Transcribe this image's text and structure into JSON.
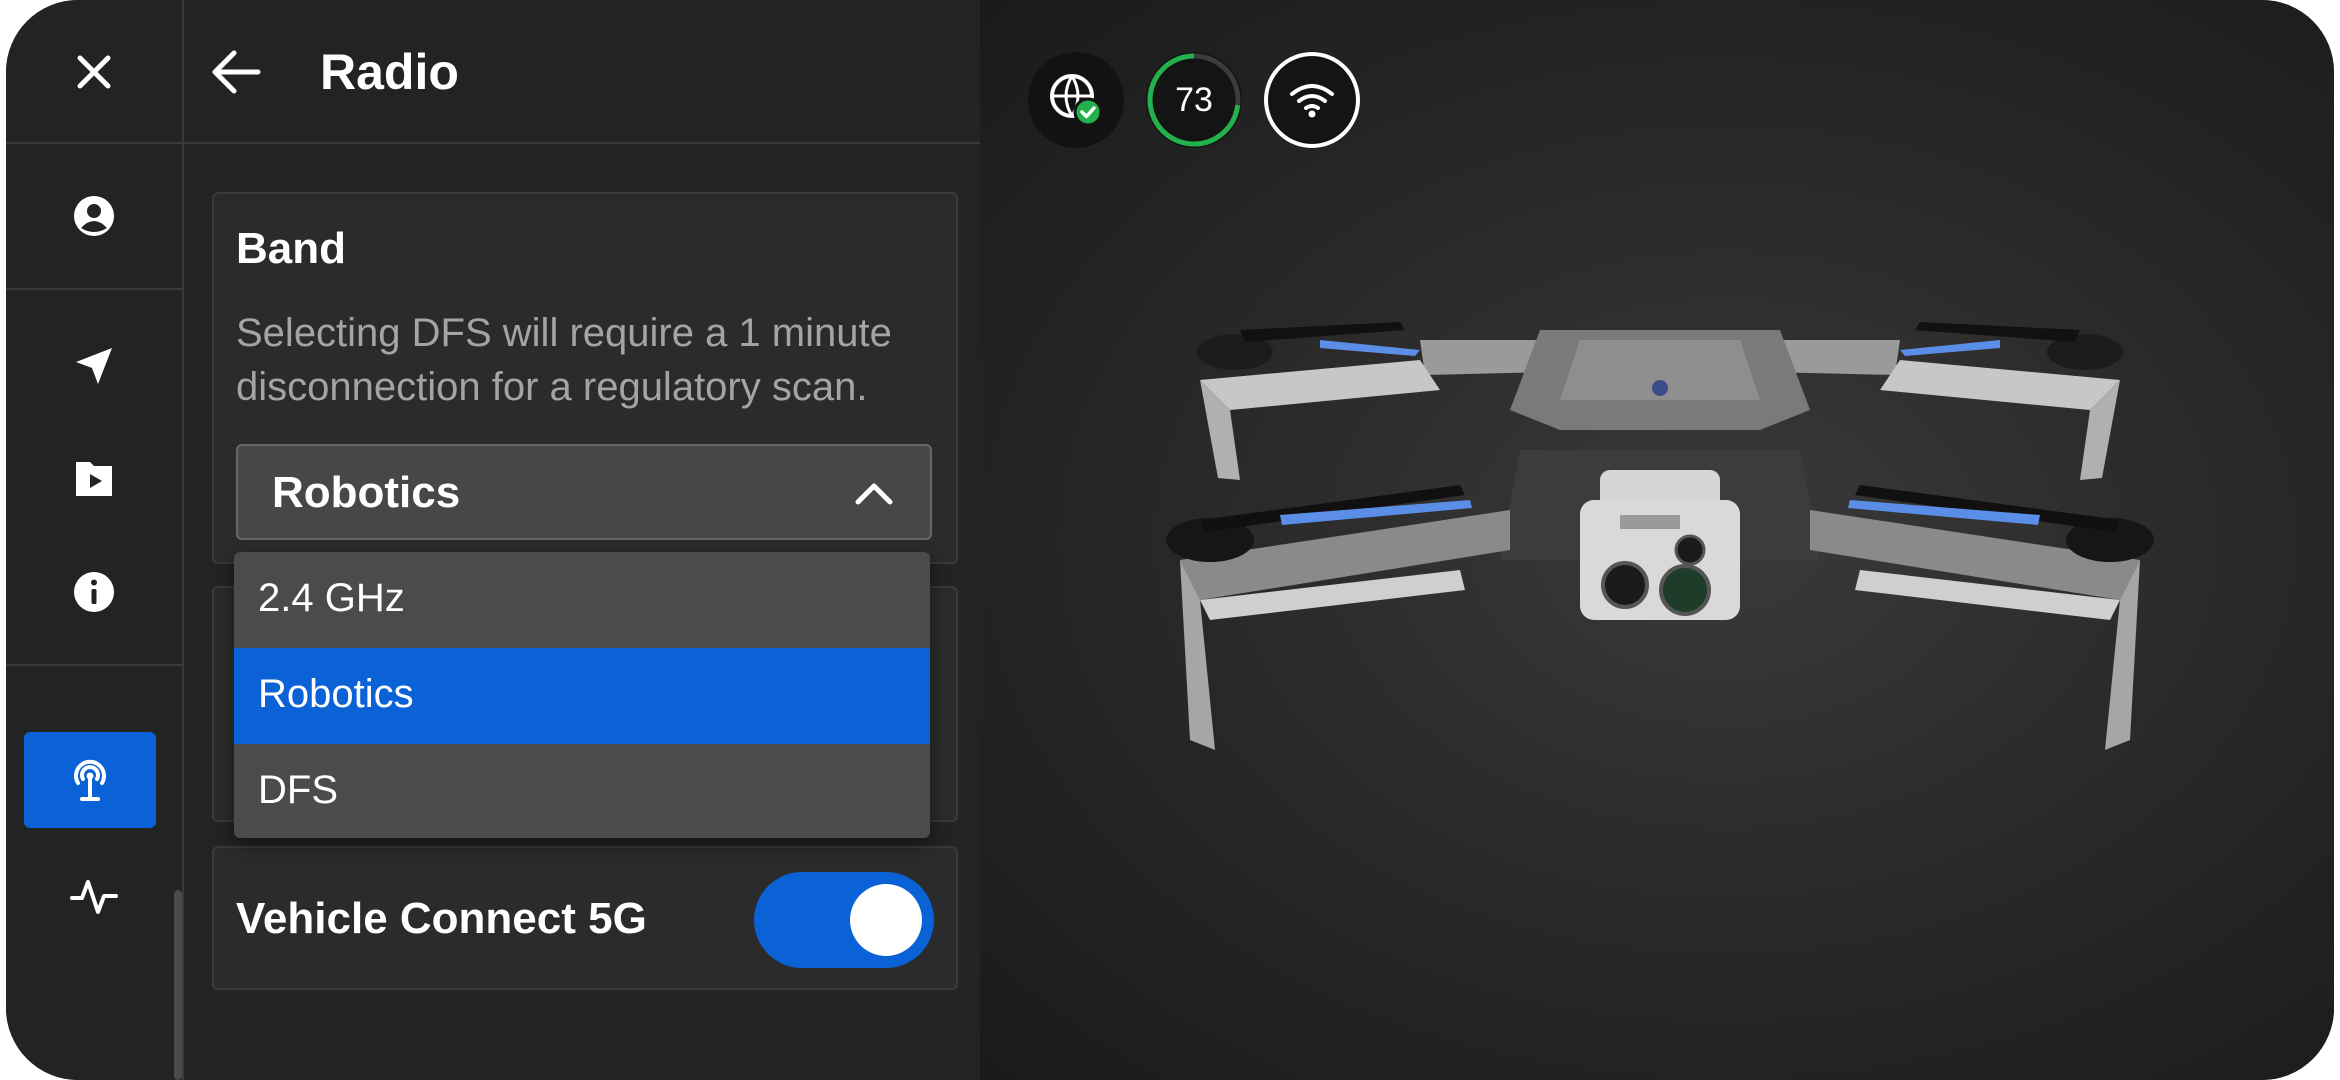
{
  "header": {
    "title": "Radio"
  },
  "band": {
    "title": "Band",
    "description": "Selecting DFS will require a 1 minute disconnection for a regulatory scan.",
    "selected": "Robotics",
    "options": [
      {
        "label": "2.4 GHz",
        "selected": false
      },
      {
        "label": "Robotics",
        "selected": true
      },
      {
        "label": "DFS",
        "selected": false
      }
    ]
  },
  "vehicle_connect": {
    "label": "Vehicle Connect 5G",
    "enabled": true
  },
  "status": {
    "battery_percent": "73"
  },
  "rail": {
    "icons": [
      "close-icon",
      "user-icon",
      "navigation-icon",
      "media-folder-icon",
      "info-icon",
      "radio-antenna-icon",
      "activity-icon"
    ],
    "active": "radio-antenna-icon"
  },
  "colors": {
    "accent": "#0a62d6",
    "panel": "#232323",
    "card": "#2b2b2b",
    "success": "#22b14c"
  }
}
